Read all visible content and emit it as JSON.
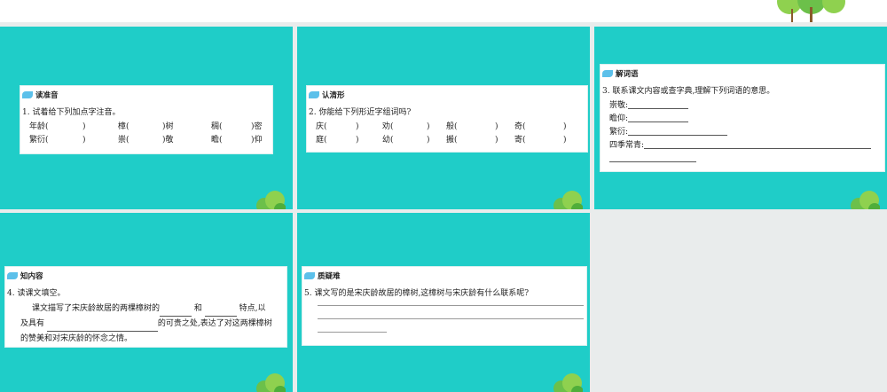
{
  "slides": [
    {
      "heading": "读准音",
      "question": "1. 试着给下列加点字注音。",
      "rows": [
        [
          "年龄(",
          ")",
          "樟(",
          ")树",
          "稠(",
          ")密"
        ],
        [
          "繁衍(",
          ")",
          "崇(",
          ")敬",
          "瞻(",
          ")仰"
        ]
      ]
    },
    {
      "heading": "认清形",
      "question": "2. 你能给下列形近字组词吗?",
      "rows": [
        [
          "庆(",
          ")",
          "劝(",
          ")",
          "般(",
          ")",
          "奇(",
          ")"
        ],
        [
          "庭(",
          ")",
          "幼(",
          ")",
          "搬(",
          ")",
          "寄(",
          ")"
        ]
      ]
    },
    {
      "heading": "解词语",
      "question": "3. 联系课文内容或查字典,理解下列词语的意思。",
      "terms": [
        "崇敬:",
        "瞻仰:",
        "繁衍:",
        "四季常青:"
      ]
    },
    {
      "heading": "知内容",
      "question": "4. 读课文填空。",
      "p1": "课文描写了宋庆龄故居的两棵樟树的",
      "p2": "和",
      "p3": "特点,以",
      "p4": "及具有",
      "p5": "的可贵之处,表达了对这两棵樟树",
      "p6": "的赞美和对宋庆龄的怀念之情。"
    },
    {
      "heading": "质疑难",
      "question": "5. 课文写的是宋庆龄故居的樟树,这樟树与宋庆龄有什么联系呢?"
    }
  ],
  "colors": {
    "teal": "#1fcdc8",
    "bg": "#e9ecec"
  }
}
